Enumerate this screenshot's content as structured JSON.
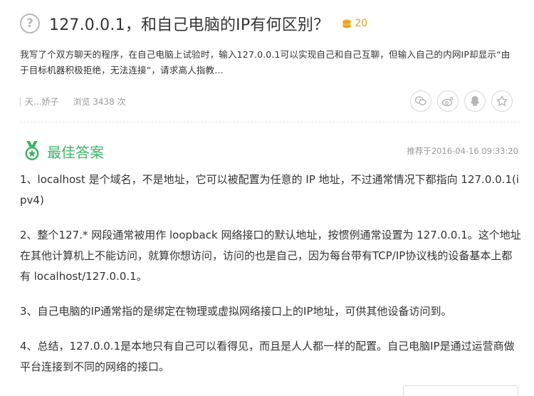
{
  "question": {
    "icon": "question-circle-icon",
    "title": "127.0.0.1，和自己电脑的IP有何区别？",
    "reward": "20",
    "reward_icon": "coin-stack-icon",
    "description": "我写了个双方聊天的程序，在自己电脑上试验时，输入127.0.0.1可以实现自己和自己互聊，但输入自己的内网IP却显示“由于目标机器积极拒绝，无法连接”，请求高人指教…",
    "author": "天...娇子",
    "views": "浏览 3438 次"
  },
  "share": {
    "buttons": [
      {
        "name": "wechat",
        "icon": "wechat-icon"
      },
      {
        "name": "weibo",
        "icon": "weibo-icon"
      },
      {
        "name": "qq",
        "icon": "qq-icon"
      },
      {
        "name": "favorite",
        "icon": "star-icon"
      }
    ]
  },
  "best_answer": {
    "icon": "medal-icon",
    "title": "最佳答案",
    "recommended_time": "推荐于2016-04-16 09:33:20",
    "paragraphs": [
      "1、localhost 是个域名，不是地址，它可以被配置为任意的 IP 地址，不过通常情况下都指向 127.0.0.1(ipv4)",
      "2、整个127.* 网段通常被用作 loopback 网络接口的默认地址，按惯例通常设置为 127.0.0.1。这个地址在其他计算机上不能访问，就算你想访问，访问的也是自己，因为每台带有TCP/IP协议栈的设备基本上都有 localhost/127.0.0.1。",
      "3、自己电脑的IP通常指的是绑定在物理或虚拟网络接口上的IP地址，可供其他设备访问到。",
      "4、总结，127.0.0.1是本地只有自己可以看得见，而且是人人都一样的配置。自己电脑IP是通过运营商做平台连接到不同的网络的接口。"
    ]
  },
  "colors": {
    "accent_green": "#3fb468",
    "reward_gold": "#e5a019",
    "muted_text": "#999999"
  }
}
